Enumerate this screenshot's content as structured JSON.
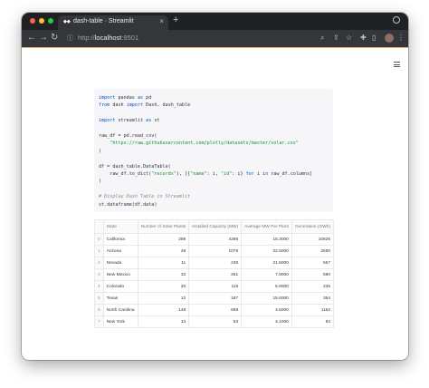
{
  "browser": {
    "tab_title": "dash-table · Streamlit",
    "tab_close": "×",
    "new_tab": "+",
    "url_scheme": "http://",
    "url_host": "localhost",
    "url_port": ":8501"
  },
  "code": {
    "lines": [
      [
        {
          "t": "import",
          "c": "kw"
        },
        {
          "t": " pandas "
        },
        {
          "t": "as",
          "c": "kw"
        },
        {
          "t": " pd"
        }
      ],
      [
        {
          "t": "from",
          "c": "kw"
        },
        {
          "t": " dash "
        },
        {
          "t": "import",
          "c": "kw"
        },
        {
          "t": " Dash, dash_table"
        }
      ],
      [],
      [
        {
          "t": "import",
          "c": "kw"
        },
        {
          "t": " streamlit "
        },
        {
          "t": "as",
          "c": "kw"
        },
        {
          "t": " st"
        }
      ],
      [],
      [
        {
          "t": "raw_df = pd.read_csv("
        }
      ],
      [
        {
          "t": "    "
        },
        {
          "t": "\"https://raw.githubusercontent.com/plotly/datasets/master/solar.csv\"",
          "c": "str"
        }
      ],
      [
        {
          "t": ")"
        }
      ],
      [],
      [
        {
          "t": "df = dash_table.DataTable("
        }
      ],
      [
        {
          "t": "    raw_df.to_dict("
        },
        {
          "t": "\"records\"",
          "c": "str"
        },
        {
          "t": "), [{"
        },
        {
          "t": "\"name\"",
          "c": "str"
        },
        {
          "t": ": i, "
        },
        {
          "t": "\"id\"",
          "c": "str"
        },
        {
          "t": ": i} "
        },
        {
          "t": "for",
          "c": "kw"
        },
        {
          "t": " i "
        },
        {
          "t": "in",
          "c": "kw"
        },
        {
          "t": " raw_df.columns]"
        }
      ],
      [
        {
          "t": ")"
        }
      ],
      [],
      [
        {
          "t": "# Display Dash Table in Streamlit",
          "c": "cm"
        }
      ],
      [
        {
          "t": "st.dataframe(df.data)"
        }
      ]
    ]
  },
  "table": {
    "columns": [
      "",
      "State",
      "Number of Solar Plants",
      "Installed Capacity (MW)",
      "Average MW Per Plant",
      "Generation (GWh)"
    ],
    "rows": [
      [
        "0",
        "California",
        "289",
        "4395",
        "15.3000",
        "10826"
      ],
      [
        "1",
        "Arizona",
        "48",
        "1078",
        "22.5000",
        "2550"
      ],
      [
        "2",
        "Nevada",
        "11",
        "238",
        "21.6000",
        "557"
      ],
      [
        "3",
        "New Mexico",
        "33",
        "261",
        "7.9000",
        "590"
      ],
      [
        "4",
        "Colorado",
        "20",
        "118",
        "5.9000",
        "235"
      ],
      [
        "5",
        "Texas",
        "12",
        "187",
        "15.6000",
        "354"
      ],
      [
        "6",
        "North Carolina",
        "148",
        "669",
        "4.5000",
        "1162"
      ],
      [
        "7",
        "New York",
        "13",
        "53",
        "4.1000",
        "84"
      ]
    ]
  },
  "colors": {
    "tabbar": "#202124",
    "toolbar": "#35363a",
    "traffic_red": "#ff5f57",
    "traffic_yellow": "#febc2e",
    "traffic_green": "#28c840",
    "code_bg": "#f6f6f9"
  }
}
